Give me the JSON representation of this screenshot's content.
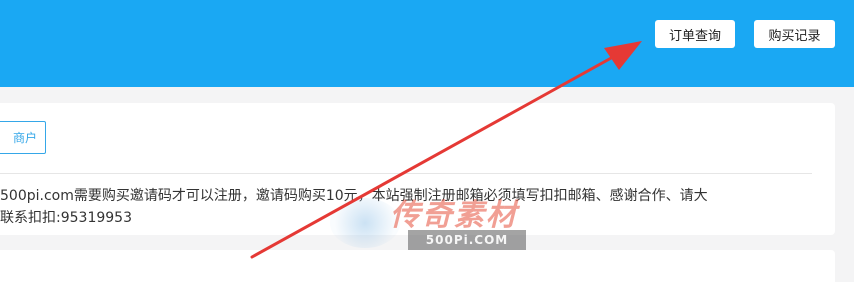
{
  "header": {
    "order_query_label": "订单查询",
    "purchase_records_label": "购买记录"
  },
  "main": {
    "outline_button_label": "商户",
    "notice_line1": "500pi.com需要购买邀请码才可以注册，邀请码购买10元，本站强制注册邮箱必须填写扣扣邮箱、感谢合作、请大",
    "notice_line2": "联系扣扣:95319953"
  },
  "watermark": {
    "script_text": "传奇素材",
    "badge_text": "500Pi.COM"
  },
  "colors": {
    "header_bg": "#1aa8f3",
    "accent": "#35a7e8",
    "arrow": "#e53935"
  }
}
